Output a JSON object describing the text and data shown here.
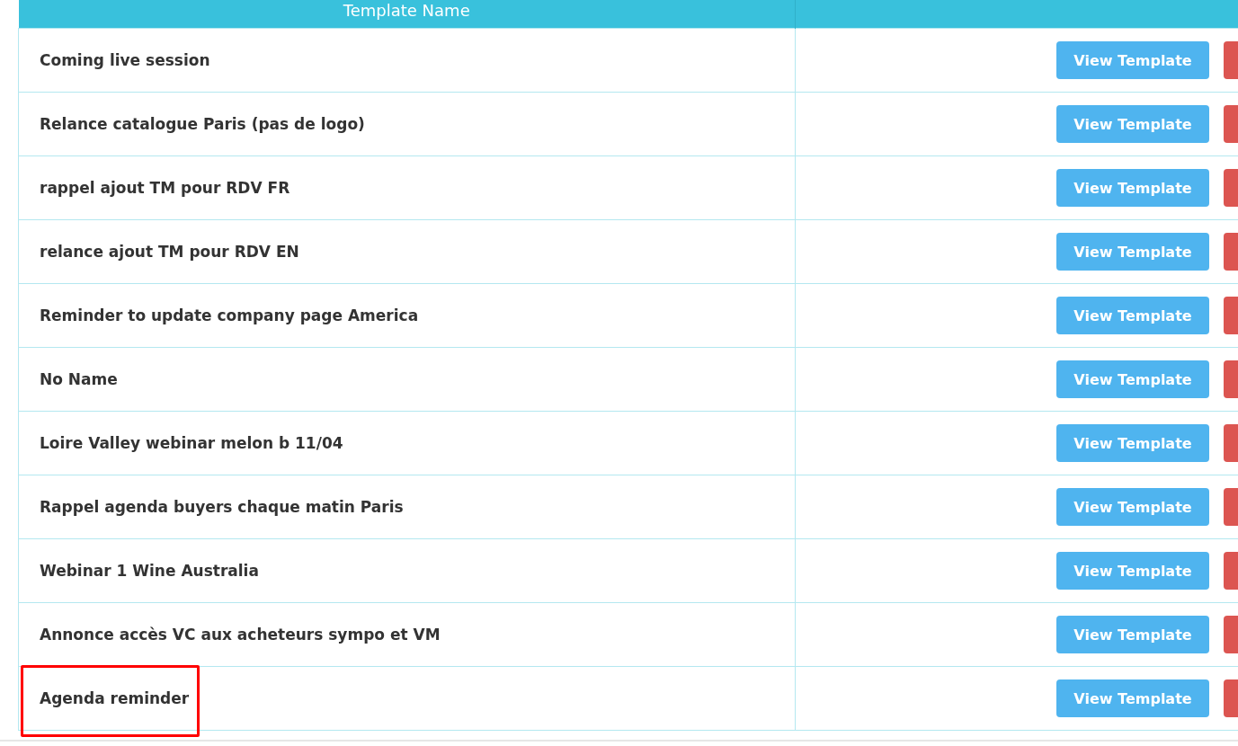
{
  "table": {
    "columns": [
      "Template Name"
    ],
    "rows": [
      {
        "name": "Coming live session",
        "action": "View Template",
        "highlighted": false
      },
      {
        "name": "Relance catalogue Paris (pas de logo)",
        "action": "View Template",
        "highlighted": false
      },
      {
        "name": "rappel ajout TM pour RDV FR",
        "action": "View Template",
        "highlighted": false
      },
      {
        "name": "relance ajout TM pour RDV EN",
        "action": "View Template",
        "highlighted": false
      },
      {
        "name": "Reminder to update company page America",
        "action": "View Template",
        "highlighted": false
      },
      {
        "name": "No Name",
        "action": "View Template",
        "highlighted": false
      },
      {
        "name": "Loire Valley webinar melon b 11/04",
        "action": "View Template",
        "highlighted": false
      },
      {
        "name": "Rappel agenda buyers chaque matin Paris",
        "action": "View Template",
        "highlighted": false
      },
      {
        "name": "Webinar 1 Wine Australia",
        "action": "View Template",
        "highlighted": false
      },
      {
        "name": "Annonce accès VC aux acheteurs sympo et VM",
        "action": "View Template",
        "highlighted": false
      },
      {
        "name": "Agenda reminder",
        "action": "View Template",
        "highlighted": true
      }
    ]
  }
}
